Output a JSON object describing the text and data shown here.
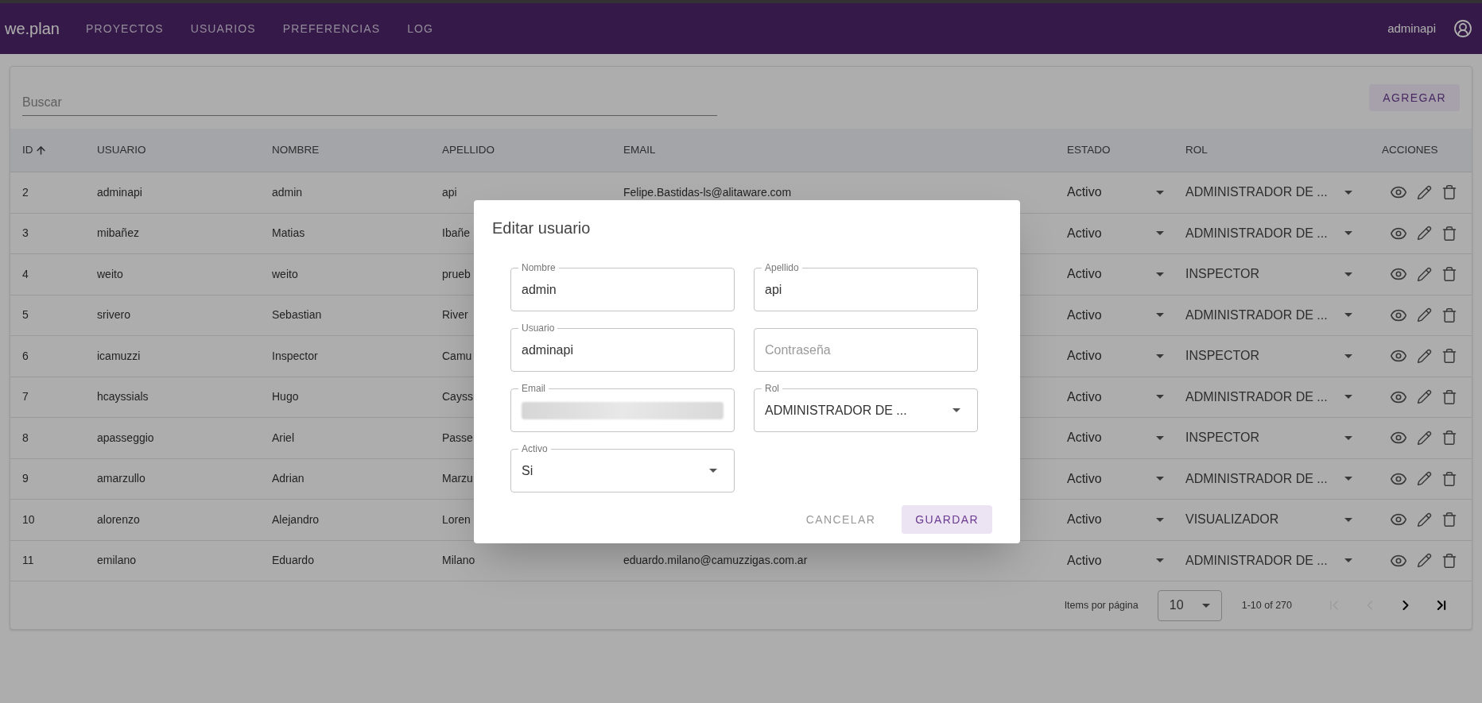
{
  "app": {
    "logo": "we.plan",
    "nav": [
      {
        "label": "PROYECTOS"
      },
      {
        "label": "USUARIOS"
      },
      {
        "label": "PREFERENCIAS"
      },
      {
        "label": "LOG"
      }
    ],
    "user": "adminapi"
  },
  "search": {
    "placeholder": "Buscar"
  },
  "add_button": "AGREGAR",
  "table": {
    "columns": [
      {
        "label": "ID",
        "sort_ascending": true
      },
      {
        "label": "USUARIO"
      },
      {
        "label": "NOMBRE"
      },
      {
        "label": "APELLIDO"
      },
      {
        "label": "EMAIL"
      },
      {
        "label": "ESTADO"
      },
      {
        "label": "ROL"
      },
      {
        "label": "ACCIONES"
      }
    ],
    "rows": [
      {
        "id": "2",
        "usuario": "adminapi",
        "nombre": "admin",
        "apellido": "api",
        "email": "Felipe.Bastidas-ls@alitaware.com",
        "estado": "Activo",
        "rol": "ADMINISTRADOR DE ..."
      },
      {
        "id": "3",
        "usuario": "mibañez",
        "nombre": "Matias",
        "apellido": "Ibañe",
        "estado": "Activo",
        "rol": "ADMINISTRADOR DE ..."
      },
      {
        "id": "4",
        "usuario": "weito",
        "nombre": "weito",
        "apellido": "prueb",
        "estado": "Activo",
        "rol": "INSPECTOR"
      },
      {
        "id": "5",
        "usuario": "srivero",
        "nombre": "Sebastian",
        "apellido": "River",
        "estado": "Activo",
        "rol": "ADMINISTRADOR DE ..."
      },
      {
        "id": "6",
        "usuario": "icamuzzi",
        "nombre": "Inspector",
        "apellido": "Camu",
        "estado": "Activo",
        "rol": "INSPECTOR"
      },
      {
        "id": "7",
        "usuario": "hcayssials",
        "nombre": "Hugo",
        "apellido": "Cayss",
        "estado": "Activo",
        "rol": "ADMINISTRADOR DE ..."
      },
      {
        "id": "8",
        "usuario": "apasseggio",
        "nombre": "Ariel",
        "apellido": "Passe",
        "estado": "Activo",
        "rol": "INSPECTOR"
      },
      {
        "id": "9",
        "usuario": "amarzullo",
        "nombre": "Adrian",
        "apellido": "Marzu",
        "estado": "Activo",
        "rol": "ADMINISTRADOR DE ..."
      },
      {
        "id": "10",
        "usuario": "alorenzo",
        "nombre": "Alejandro",
        "apellido": "Loren",
        "estado": "Activo",
        "rol": "VISUALIZADOR"
      },
      {
        "id": "11",
        "usuario": "emilano",
        "nombre": "Eduardo",
        "apellido": "Milano",
        "email": "eduardo.milano@camuzzigas.com.ar",
        "estado": "Activo",
        "rol": "ADMINISTRADOR DE ..."
      }
    ]
  },
  "paginator": {
    "label": "Items por página",
    "page_size": "10",
    "range": "1-10 of 270",
    "buttons": [
      {
        "kind": "first",
        "disabled": true
      },
      {
        "kind": "prev",
        "disabled": true
      },
      {
        "kind": "next",
        "disabled": false
      },
      {
        "kind": "last",
        "disabled": false
      }
    ]
  },
  "dialog": {
    "title": "Editar usuario",
    "fields": [
      {
        "kind": "text",
        "label": "Nombre",
        "value": "admin"
      },
      {
        "kind": "text",
        "label": "Apellido",
        "value": "api"
      },
      {
        "kind": "text",
        "label": "Usuario",
        "value": "adminapi"
      },
      {
        "kind": "text",
        "placeholder": "Contraseña"
      },
      {
        "kind": "redacted",
        "label": "Email"
      },
      {
        "kind": "select",
        "label": "Rol",
        "value": "ADMINISTRADOR DE ..."
      },
      {
        "kind": "select",
        "label": "Activo",
        "value": "Si"
      }
    ],
    "buttons": [
      {
        "kind": "text",
        "label": "CANCELAR"
      },
      {
        "kind": "tonal",
        "label": "GUARDAR"
      }
    ]
  }
}
